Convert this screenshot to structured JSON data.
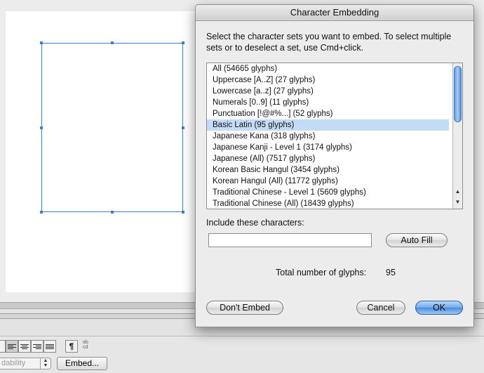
{
  "background": {
    "embed_button_label": "Embed...",
    "readability_select_value": "dability",
    "abc_icon_text": "ab\ncd"
  },
  "dialog": {
    "title": "Character Embedding",
    "instructions": "Select the character sets you want to embed. To select multiple sets or to deselect a set, use Cmd+click.",
    "character_sets": [
      {
        "label": "All  (54665 glyphs)",
        "selected": false
      },
      {
        "label": "Uppercase [A..Z]  (27 glyphs)",
        "selected": false
      },
      {
        "label": "Lowercase [a..z]  (27 glyphs)",
        "selected": false
      },
      {
        "label": "Numerals [0..9]  (11 glyphs)",
        "selected": false
      },
      {
        "label": "Punctuation [!@#%...]  (52 glyphs)",
        "selected": false
      },
      {
        "label": "Basic Latin  (95 glyphs)",
        "selected": true
      },
      {
        "label": "Japanese Kana  (318 glyphs)",
        "selected": false
      },
      {
        "label": "Japanese Kanji - Level 1 (3174 glyphs)",
        "selected": false
      },
      {
        "label": "Japanese (All)  (7517 glyphs)",
        "selected": false
      },
      {
        "label": "Korean Basic Hangul (3454 glyphs)",
        "selected": false
      },
      {
        "label": "Korean Hangul (All) (11772 glyphs)",
        "selected": false
      },
      {
        "label": "Traditional Chinese - Level 1 (5609 glyphs)",
        "selected": false
      },
      {
        "label": "Traditional Chinese (All)  (18439 glyphs)",
        "selected": false
      }
    ],
    "include_label": "Include these characters:",
    "include_value": "",
    "auto_fill_label": "Auto Fill",
    "total_label": "Total number of glyphs:",
    "total_value": "95",
    "dont_embed_label": "Don't Embed",
    "cancel_label": "Cancel",
    "ok_label": "OK"
  },
  "colors": {
    "selection": "#c3dbf6",
    "frame_blue": "#3a7fd8",
    "default_button": "#6ea9ea"
  }
}
